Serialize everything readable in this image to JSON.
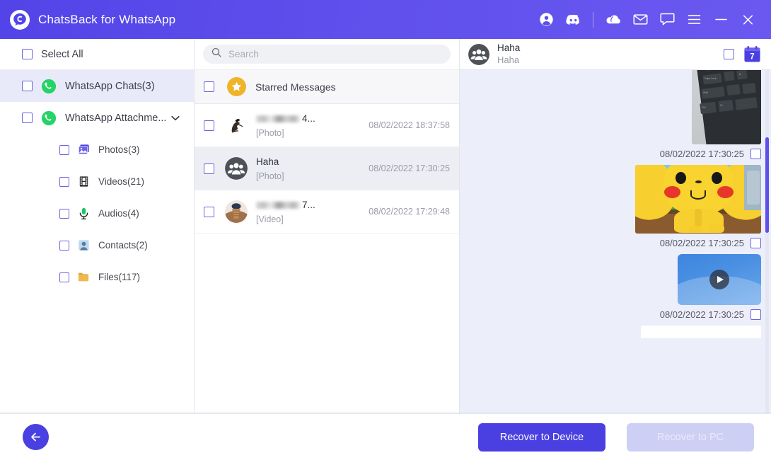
{
  "window": {
    "title": "ChatsBack for WhatsApp",
    "logo_icon": "chatsback-logo-icon",
    "controls": [
      {
        "name": "account-icon",
        "label": "Account"
      },
      {
        "name": "discord-icon",
        "label": "Discord"
      },
      {
        "name": "cloud-icon",
        "label": "Cloud"
      },
      {
        "name": "mail-icon",
        "label": "Mail"
      },
      {
        "name": "feedback-icon",
        "label": "Feedback"
      },
      {
        "name": "menu-icon",
        "label": "Menu"
      },
      {
        "name": "minimize-icon",
        "label": "Minimize"
      },
      {
        "name": "close-icon",
        "label": "Close"
      }
    ],
    "accent_color": "#5244e8",
    "titlebar_gradient_end": "#6a59f0"
  },
  "sidebar": {
    "select_all_label": "Select All",
    "items": [
      {
        "label": "WhatsApp Chats(3)",
        "icon": "whatsapp-icon",
        "level": "top",
        "active": true,
        "expandable": false
      },
      {
        "label": "WhatsApp Attachme...",
        "icon": "whatsapp-icon",
        "level": "top",
        "active": false,
        "expandable": true
      },
      {
        "label": "Photos(3)",
        "icon": "photos-icon",
        "level": "sub"
      },
      {
        "label": "Videos(21)",
        "icon": "videos-icon",
        "level": "sub"
      },
      {
        "label": "Audios(4)",
        "icon": "audios-icon",
        "level": "sub"
      },
      {
        "label": "Contacts(2)",
        "icon": "contacts-icon",
        "level": "sub"
      },
      {
        "label": "Files(117)",
        "icon": "files-icon",
        "level": "sub"
      }
    ]
  },
  "middle": {
    "search": {
      "placeholder": "Search",
      "value": "",
      "icon": "search-icon"
    },
    "starred": {
      "label": "Starred Messages",
      "icon": "star-icon"
    },
    "chats": [
      {
        "name": "",
        "name_suffix": "4...",
        "name_redacted": true,
        "preview": "[Photo]",
        "time": "08/02/2022 18:37:58",
        "avatar": "anime-character-avatar",
        "active": false
      },
      {
        "name": "Haha",
        "name_suffix": "",
        "name_redacted": false,
        "preview": "[Photo]",
        "time": "08/02/2022 17:30:25",
        "avatar": "group-avatar",
        "active": true
      },
      {
        "name": "",
        "name_suffix": "7...",
        "name_redacted": true,
        "preview": "[Video]",
        "time": "08/02/2022 17:29:48",
        "avatar": "brown-photo-avatar",
        "active": false
      }
    ]
  },
  "conversation": {
    "header": {
      "title": "Haha",
      "subtitle": "Haha",
      "avatar": "group-avatar",
      "calendar_icon": "calendar-icon",
      "calendar_day": "7"
    },
    "messages": [
      {
        "type": "photo",
        "media": "keyboard-photo",
        "time": "08/02/2022 17:30:25"
      },
      {
        "type": "photo",
        "media": "pikachu-photo",
        "time": "08/02/2022 17:30:25"
      },
      {
        "type": "video",
        "media": "video-thumbnail",
        "time": "08/02/2022 17:30:25"
      }
    ],
    "scrollbar": {
      "name": "conversation-scrollbar"
    }
  },
  "footer": {
    "back_icon": "back-arrow-icon",
    "recover_device_label": "Recover to Device",
    "recover_pc_label": "Recover to PC",
    "primary_color": "#4a3fe0",
    "disabled_color": "#cdd0f4"
  }
}
